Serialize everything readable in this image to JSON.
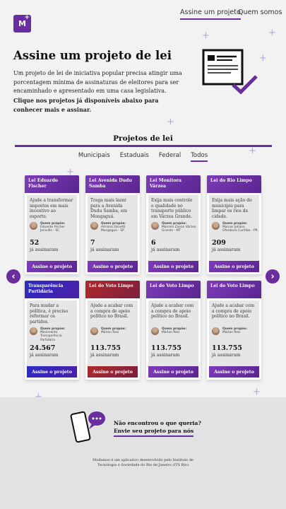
{
  "nav": {
    "logo": "M",
    "links": [
      "Assine um projeto",
      "Quem somos"
    ]
  },
  "hero": {
    "title": "Assine um projeto de lei",
    "text": "Um projeto de lei de iniciativa popular precisa atingir uma porcentagem mínima de assinaturas de eleitores para ser encaminhado e apresentado em uma casa legislativa.",
    "text_bold": "Clique nos projetos já disponíveis abaixo para conhecer mais e assinar."
  },
  "section": {
    "title": "Projetos de lei",
    "filters": [
      "Municipais",
      "Estaduais",
      "Federal",
      "Todos"
    ],
    "active_filter": "Todos"
  },
  "cards": [
    {
      "title": "Lei Eduardo Fischer",
      "desc": "Ajude a transformar impostos em mais incentivo ao esporte.",
      "author_label": "Quem propõe:",
      "author": "Eduardo Fischer Joinville - SC",
      "count": "52",
      "count_label": "já assinaram",
      "button": "Assine o projeto",
      "theme": "purple"
    },
    {
      "title": "Lei Avenida Dudu Samba",
      "desc": "Traga mais lazer para a Avenida Dudu Samba, em Mongaguá.",
      "author_label": "Quem propõe:",
      "author": "Adriano Donetti Mongaguá - SP",
      "count": "7",
      "count_label": "já assinaram",
      "button": "Assine o projeto",
      "theme": "purple"
    },
    {
      "title": "Lei Monitora Várzea",
      "desc": "Exija mais controle e qualidade no transporte público em Várzea Grande.",
      "author_label": "Quem propõe:",
      "author": "Marcelo Zavan Várzea Grande - MT",
      "count": "6",
      "count_label": "já assinaram",
      "button": "Assine o projeto",
      "theme": "purple"
    },
    {
      "title": "Lei do Rio Limpo",
      "desc": "Exija mais ação do município para limpar os rios da cidade.",
      "author_label": "Quem propõe:",
      "author": "Marcos Juliano Ofenbock Curitiba - PR",
      "count": "209",
      "count_label": "já assinaram",
      "button": "Assine o projeto",
      "theme": "purple"
    },
    {
      "title": "Transparência Partidária",
      "desc": "Para mudar a política, é preciso reformar os partidos.",
      "author_label": "Quem propõe:",
      "author": "Movimento Transparência Partidária",
      "count": "24.567",
      "count_label": "já assinaram",
      "button": "Assine o projeto",
      "theme": "blue"
    },
    {
      "title": "Lei do Voto Limpo",
      "desc": "Ajude a acabar com a compra de apoio político no Brasil.",
      "author_label": "Quem propõe:",
      "author": "Márlon Reis",
      "count": "113.755",
      "count_label": "já assinaram",
      "button": "Assine o projeto",
      "theme": "red"
    },
    {
      "title": "Lei do Voto Limpo",
      "desc": "Ajude a acabar com a compra de apoio político no Brasil.",
      "author_label": "Quem propõe:",
      "author": "Márlon Reis",
      "count": "113.755",
      "count_label": "já assinaram",
      "button": "Assine o projeto",
      "theme": "purple"
    },
    {
      "title": "Lei do Voto Limpo",
      "desc": "Ajude a acabar com a compra de apoio político no Brasil.",
      "author_label": "Quem propõe:",
      "author": "Márlon Reis",
      "count": "113.755",
      "count_label": "já assinaram",
      "button": "Assine o projeto",
      "theme": "purple"
    }
  ],
  "carousel": {
    "prev_icon": "‹",
    "next_icon": "›"
  },
  "footer": {
    "question": "Não encontrou o que queria?",
    "link": "Envie seu projeto para nós",
    "credit": "Mudamos é um aplicativo desenvolvido pelo Instituto de Tecnologia e Sociedade do Rio de Janeiro (ITS Rio)"
  },
  "colors": {
    "accent": "#6a2d9f",
    "blue": "#2c2cc4",
    "red": "#b02a2a"
  }
}
